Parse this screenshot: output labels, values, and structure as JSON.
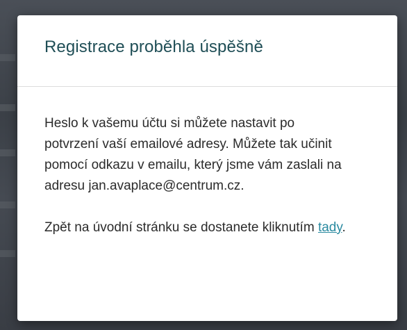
{
  "modal": {
    "title": "Registrace proběhla úspěšně",
    "message": "Heslo k vašemu účtu si můžete nastavit po potvrzení vaší emailové adresy. Můžete tak učinit pomocí odkazu v emailu, který jsme vám zaslali na adresu jan.avaplace@centrum.cz.",
    "return_prefix": "Zpět na úvodní stránku se dostanete kliknutím ",
    "return_link": "tady",
    "return_suffix": "."
  },
  "colors": {
    "title": "#1f4e56",
    "link": "#2a8aa0",
    "text": "#2b2b2b",
    "backdrop": "#3e434a"
  }
}
